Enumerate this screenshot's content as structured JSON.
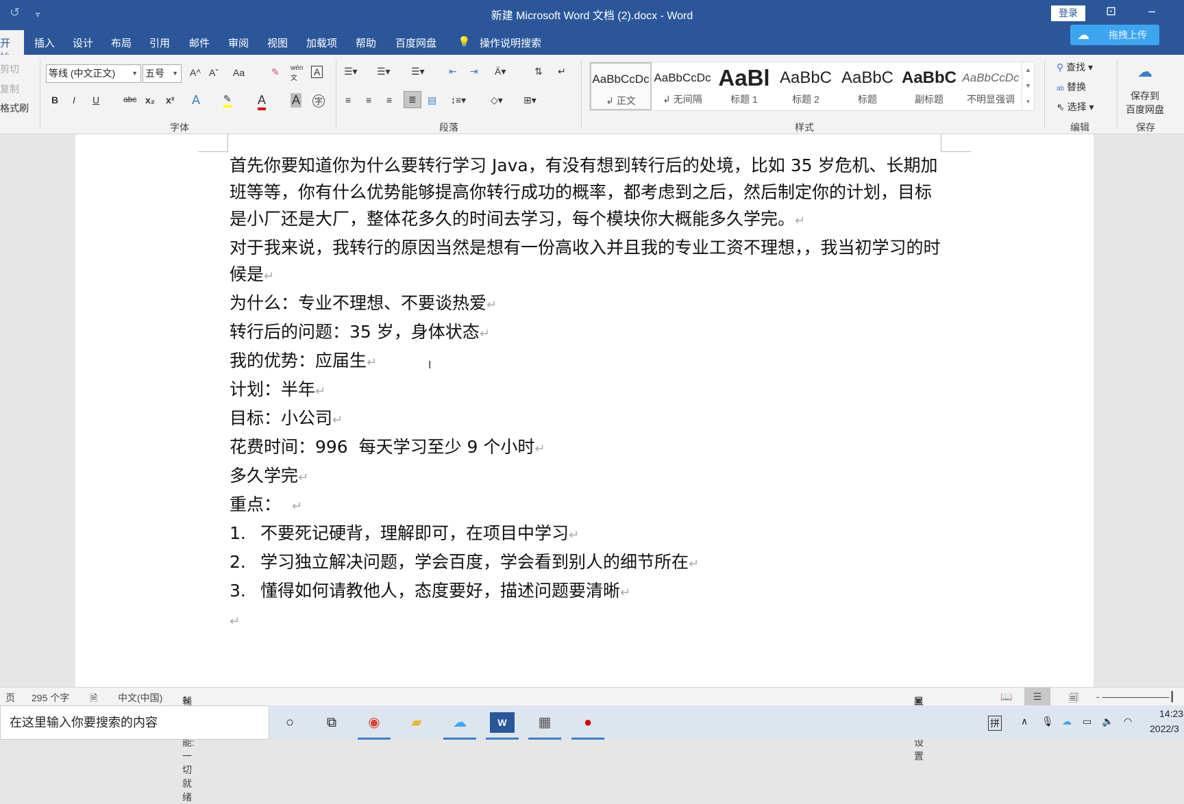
{
  "titlebar": {
    "title": "新建 Microsoft Word 文档 (2).docx  -  Word",
    "login": "登录",
    "undo_icon": "undo-icon",
    "customize_icon": "▿"
  },
  "tabs": [
    "开始",
    "插入",
    "设计",
    "布局",
    "引用",
    "邮件",
    "审阅",
    "视图",
    "加载项",
    "帮助",
    "百度网盘"
  ],
  "tell_me": "操作说明搜索",
  "upload_button": "拖拽上传",
  "ribbon": {
    "clipboard": {
      "cut": "剪切",
      "copy": "复制",
      "format_painter": "格式刷"
    },
    "font": {
      "font_name": "等线 (中文正文)",
      "font_size": "五号",
      "label": "字体",
      "bold": "B",
      "italic": "I",
      "underline": "U",
      "strike": "abc",
      "sub": "x₂",
      "sup": "x²",
      "change_case": "Aa",
      "grow": "A^",
      "shrink": "Aˇ",
      "phonetic": "wén 文",
      "border_char": "A",
      "effects": "A",
      "font_color": "A",
      "shading": "A",
      "enclose": "字"
    },
    "paragraph": {
      "label": "段落"
    },
    "styles": {
      "label": "样式",
      "items": [
        {
          "preview": "AaBbCcDc",
          "name": "↲ 正文"
        },
        {
          "preview": "AaBbCcDc",
          "name": "↲ 无间隔"
        },
        {
          "preview": "AaBl",
          "name": "标题 1"
        },
        {
          "preview": "AaBbC",
          "name": "标题 2"
        },
        {
          "preview": "AaBbC",
          "name": "标题"
        },
        {
          "preview": "AaBbC",
          "name": "副标题"
        },
        {
          "preview": "AaBbCcDc",
          "name": "不明显强调"
        }
      ]
    },
    "editing": {
      "label": "编辑",
      "find": "查找",
      "replace": "替换",
      "select": "选择"
    },
    "save": {
      "label": "保存",
      "save_to": "保存到",
      "baidu": "百度网盘"
    }
  },
  "document": {
    "paragraphs": [
      "首先你要知道你为什么要转行学习 Java，有没有想到转行后的处境，比如 35 岁危机、长期加班等等，你有什么优势能够提高你转行成功的概率，都考虑到之后，然后制定你的计划，目标是小厂还是大厂，整体花多久的时间去学习，每个模块你大概能多久学完。",
      "对于我来说，我转行的原因当然是想有一份高收入并且我的专业工资不理想，，我当初学习的时候是",
      "为什么：专业不理想、不要谈热爱",
      "转行后的问题：35 岁，身体状态",
      "我的优势：应届生",
      "计划：半年",
      "目标：小公司",
      "花费时间：996  每天学习至少 9 个小时",
      "多久学完",
      "重点：  "
    ],
    "list": [
      {
        "num": "1.",
        "text": "不要死记硬背，理解即可，在项目中学习"
      },
      {
        "num": "2.",
        "text": "学习独立解决问题，学会百度，学会看到别人的细节所在"
      },
      {
        "num": "3.",
        "text": "懂得如何请教他人，态度要好，描述问题要清晰"
      }
    ],
    "paragraph_mark": "↵"
  },
  "status": {
    "page": "页",
    "word_count": "295 个字",
    "language": "中文(中国)",
    "accessibility": "辅助功能: 一切就绪",
    "display_settings": "显示器设置"
  },
  "taskbar": {
    "search_placeholder": "在这里输入你要搜索的内容",
    "ime": "拼",
    "time": "14:23",
    "date": "2022/3"
  },
  "colors": {
    "title_bar": "#2b579a",
    "ribbon": "#f3f3f3",
    "upload": "#3da5f0"
  }
}
